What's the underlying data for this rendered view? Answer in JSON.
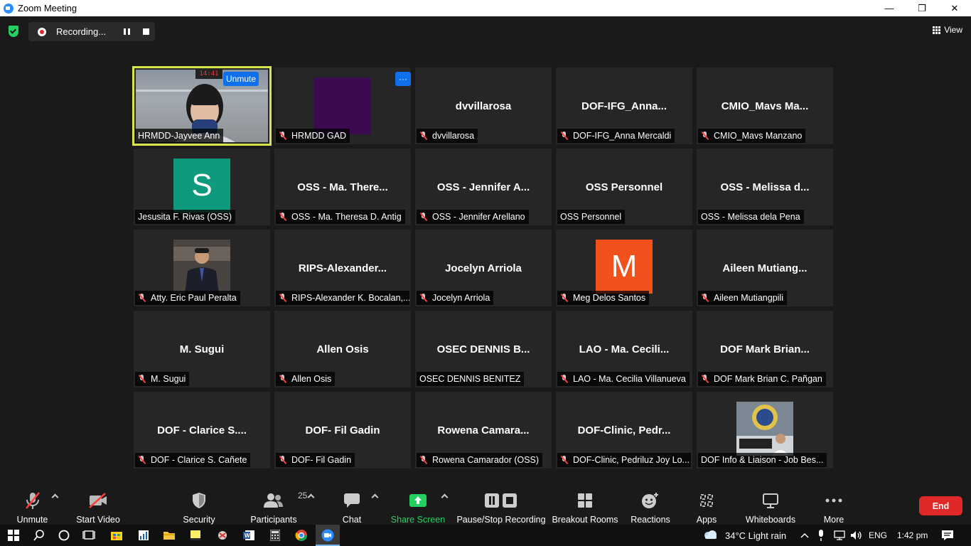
{
  "window": {
    "title": "Zoom Meeting",
    "minimize": "—",
    "restore": "❐",
    "close": "✕"
  },
  "topbar": {
    "recording_label": "Recording...",
    "view_label": "View"
  },
  "active_overlay": {
    "unmute_label": "Unmute",
    "more_label": "···"
  },
  "tiles": [
    {
      "name": "HRMDD-Jayvee Ann",
      "big": "",
      "muted": false,
      "kind": "video-jayvee"
    },
    {
      "name": "HRMDD GAD",
      "big": "",
      "muted": true,
      "kind": "purple"
    },
    {
      "name": "dvvillarosa",
      "big": "dvvillarosa",
      "muted": true,
      "kind": "name"
    },
    {
      "name": "DOF-IFG_Anna Mercaldi",
      "big": "DOF-IFG_Anna...",
      "muted": true,
      "kind": "name"
    },
    {
      "name": "CMIO_Mavs Manzano",
      "big": "CMIO_Mavs  Ma...",
      "muted": true,
      "kind": "name"
    },
    {
      "name": "Jesusita F. Rivas (OSS)",
      "big": "",
      "muted": false,
      "kind": "avatar-s"
    },
    {
      "name": "OSS - Ma. Theresa D. Antig",
      "big": "OSS  -  Ma.  There...",
      "muted": true,
      "kind": "name"
    },
    {
      "name": "OSS - Jennifer Arellano",
      "big": "OSS  -  Jennifer  A...",
      "muted": true,
      "kind": "name"
    },
    {
      "name": "OSS Personnel",
      "big": "OSS Personnel",
      "muted": false,
      "kind": "name"
    },
    {
      "name": "OSS - Melissa dela Pena",
      "big": "OSS  -  Melissa  d...",
      "muted": false,
      "kind": "name"
    },
    {
      "name": "Atty. Eric Paul Peralta",
      "big": "",
      "muted": true,
      "kind": "photo-eric"
    },
    {
      "name": "RIPS-Alexander K. Bocalan,...",
      "big": "RIPS-Alexander...",
      "muted": true,
      "kind": "name"
    },
    {
      "name": "Jocelyn Arriola",
      "big": "Jocelyn Arriola",
      "muted": true,
      "kind": "name"
    },
    {
      "name": "Meg Delos Santos",
      "big": "",
      "muted": true,
      "kind": "avatar-m"
    },
    {
      "name": "Aileen Mutiangpili",
      "big": "Aileen  Mutiang...",
      "muted": true,
      "kind": "name"
    },
    {
      "name": "M. Sugui",
      "big": "M. Sugui",
      "muted": true,
      "kind": "name"
    },
    {
      "name": "Allen Osis",
      "big": "Allen Osis",
      "muted": true,
      "kind": "name"
    },
    {
      "name": "OSEC DENNIS BENITEZ",
      "big": "OSEC  DENNIS  B...",
      "muted": false,
      "kind": "name"
    },
    {
      "name": "LAO - Ma. Cecilia Villanueva",
      "big": "LAO  -  Ma.  Cecili...",
      "muted": true,
      "kind": "name"
    },
    {
      "name": "DOF Mark Brian C. Pañgan",
      "big": "DOF  Mark  Brian...",
      "muted": true,
      "kind": "name"
    },
    {
      "name": "DOF - Clarice S. Cañete",
      "big": "DOF  -  Clarice  S....",
      "muted": true,
      "kind": "name"
    },
    {
      "name": "DOF- Fil Gadin",
      "big": "DOF- Fil Gadin",
      "muted": true,
      "kind": "name"
    },
    {
      "name": "Rowena Camarador (OSS)",
      "big": "Rowena  Camara...",
      "muted": true,
      "kind": "name"
    },
    {
      "name": "DOF-Clinic, Pedriluz Joy Lo...",
      "big": "DOF-Clinic,  Pedr...",
      "muted": true,
      "kind": "name"
    },
    {
      "name": "DOF Info & Liaison - Job Bes...",
      "big": "",
      "muted": false,
      "kind": "photo-dof"
    }
  ],
  "jayvee_clock": "14:41",
  "avatars": {
    "s_letter": "S",
    "m_letter": "M",
    "s_color": "#0f9a7e",
    "m_color": "#f1511b",
    "purple_color": "#3c0a4f"
  },
  "toolbar": {
    "unmute": "Unmute",
    "start_video": "Start Video",
    "security": "Security",
    "participants": "Participants",
    "participants_count": "25",
    "chat": "Chat",
    "share_screen": "Share Screen",
    "recording": "Pause/Stop Recording",
    "breakout": "Breakout Rooms",
    "reactions": "Reactions",
    "apps": "Apps",
    "whiteboards": "Whiteboards",
    "more": "More",
    "end": "End"
  },
  "taskbar": {
    "weather": "34°C  Light rain",
    "lang": "ENG",
    "time": "1:42 pm"
  },
  "colors": {
    "accent": "#0e71eb",
    "share_green": "#23d160",
    "end_red": "#e02828",
    "active_border": "#d8e34d"
  }
}
